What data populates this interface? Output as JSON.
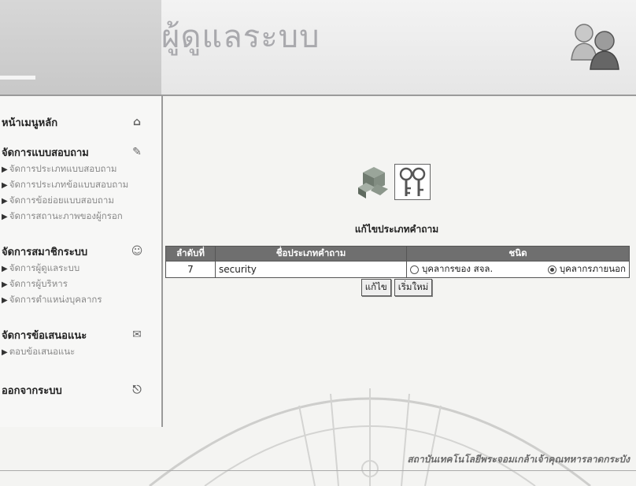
{
  "header": {
    "title": "ผู้ดูแลระบบ"
  },
  "sidebar": {
    "groups": [
      {
        "label": "หน้าเมนูหลัก",
        "icon": "home-icon",
        "items": []
      },
      {
        "label": "จัดการแบบสอบถาม",
        "icon": "survey-icon",
        "items": [
          "จัดการประเภทแบบสอบถาม",
          "จัดการประเภทข้อแบบสอบถาม",
          "จัดการข้อย่อยแบบสอบถาม",
          "จัดการสถานะภาพของผู้กรอก"
        ]
      },
      {
        "label": "จัดการสมาชิกระบบ",
        "icon": "members-icon",
        "items": [
          "จัดการผู้ดูแลระบบ",
          "จัดการผู้บริหาร",
          "จัดการตำแหน่งบุคลากร"
        ]
      },
      {
        "label": "จัดการข้อเสนอแนะ",
        "icon": "suggestion-icon",
        "items": [
          "ตอบข้อเสนอแนะ"
        ]
      },
      {
        "label": "ออกจากระบบ",
        "icon": "logout-icon",
        "items": []
      }
    ]
  },
  "form": {
    "title": "แก้ไขประเภทคำถาม",
    "columns": {
      "no": "ลำดับที่",
      "name": "ชื่อประเภทคำถาม",
      "type": "ชนิด"
    },
    "row": {
      "no": "7",
      "name": "security",
      "option_internal": "บุคลากรของ สจล.",
      "option_external": "บุคลากรภายนอก",
      "selected": "external"
    },
    "buttons": {
      "edit": "แก้ไข",
      "reset": "เริ่มใหม่"
    }
  },
  "footer": {
    "text": "สถาบันเทคโนโลยีพระจอมเกล้าเจ้าคุณทหารลาดกระบัง"
  },
  "colors": {
    "table_header": "#6f6f6f",
    "divider": "#9a9a9a"
  }
}
